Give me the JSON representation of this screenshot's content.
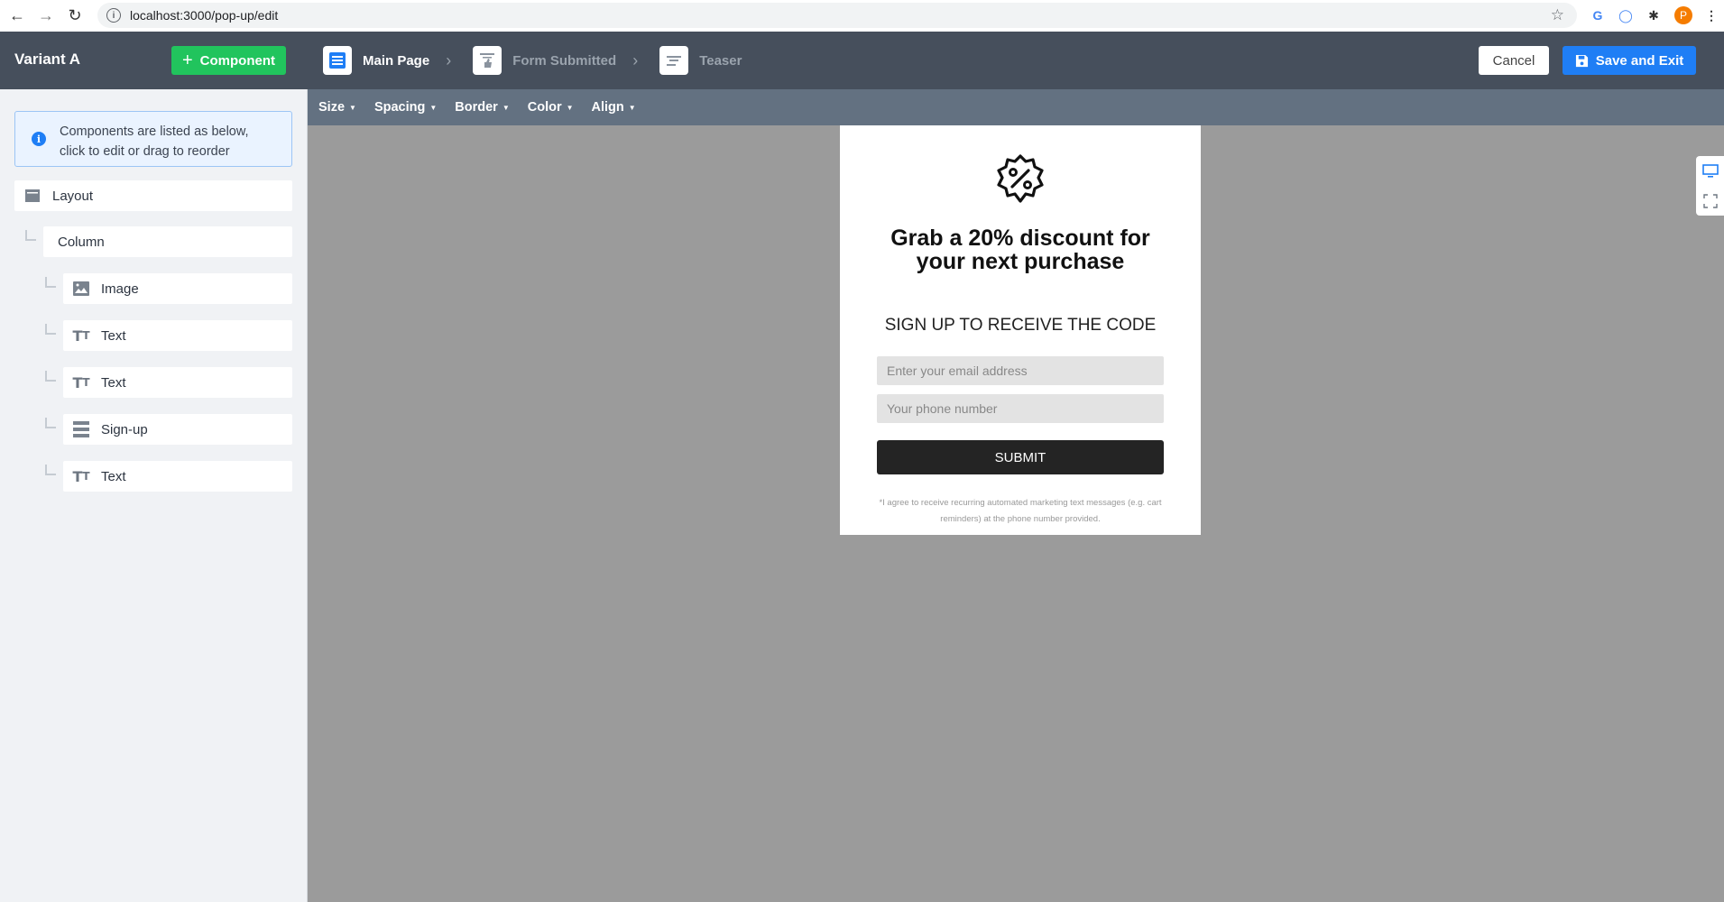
{
  "browser": {
    "url": "localhost:3000/pop-up/edit",
    "profile_initial": "P"
  },
  "header": {
    "variant_title": "Variant A",
    "add_component_label": "Component",
    "steps": [
      {
        "label": "Main Page",
        "active": true
      },
      {
        "label": "Form Submitted",
        "active": false
      },
      {
        "label": "Teaser",
        "active": false
      }
    ],
    "cancel_label": "Cancel",
    "save_label": "Save and Exit"
  },
  "sidebar": {
    "info_line1": "Components are listed as below,",
    "info_line2_a": "click to edit",
    "info_line2_b": " or ",
    "info_line2_c": "drag to reorder",
    "items": [
      {
        "label": "Layout",
        "icon": "layout-icon"
      },
      {
        "label": "Column",
        "icon": "none"
      },
      {
        "label": "Image",
        "icon": "image-icon"
      },
      {
        "label": "Text",
        "icon": "text-icon"
      },
      {
        "label": "Text",
        "icon": "text-icon"
      },
      {
        "label": "Sign-up",
        "icon": "signup-icon"
      },
      {
        "label": "Text",
        "icon": "text-icon"
      }
    ]
  },
  "toolbar": {
    "items": [
      "Size",
      "Spacing",
      "Border",
      "Color",
      "Align"
    ]
  },
  "popup": {
    "headline": "Grab a 20% discount for your next purchase",
    "subhead": "SIGN UP TO RECEIVE THE CODE",
    "email_placeholder": "Enter your email address",
    "phone_placeholder": "Your phone number",
    "submit_label": "SUBMIT",
    "disclaimer": "*I agree to receive recurring automated marketing text messages (e.g. cart reminders) at the phone number provided."
  },
  "colors": {
    "header_bg": "#464f5c",
    "toolbar_bg": "#637181",
    "canvas_bg": "#9b9b9b",
    "accent_green": "#21c45d",
    "accent_blue": "#1f7ef5"
  }
}
